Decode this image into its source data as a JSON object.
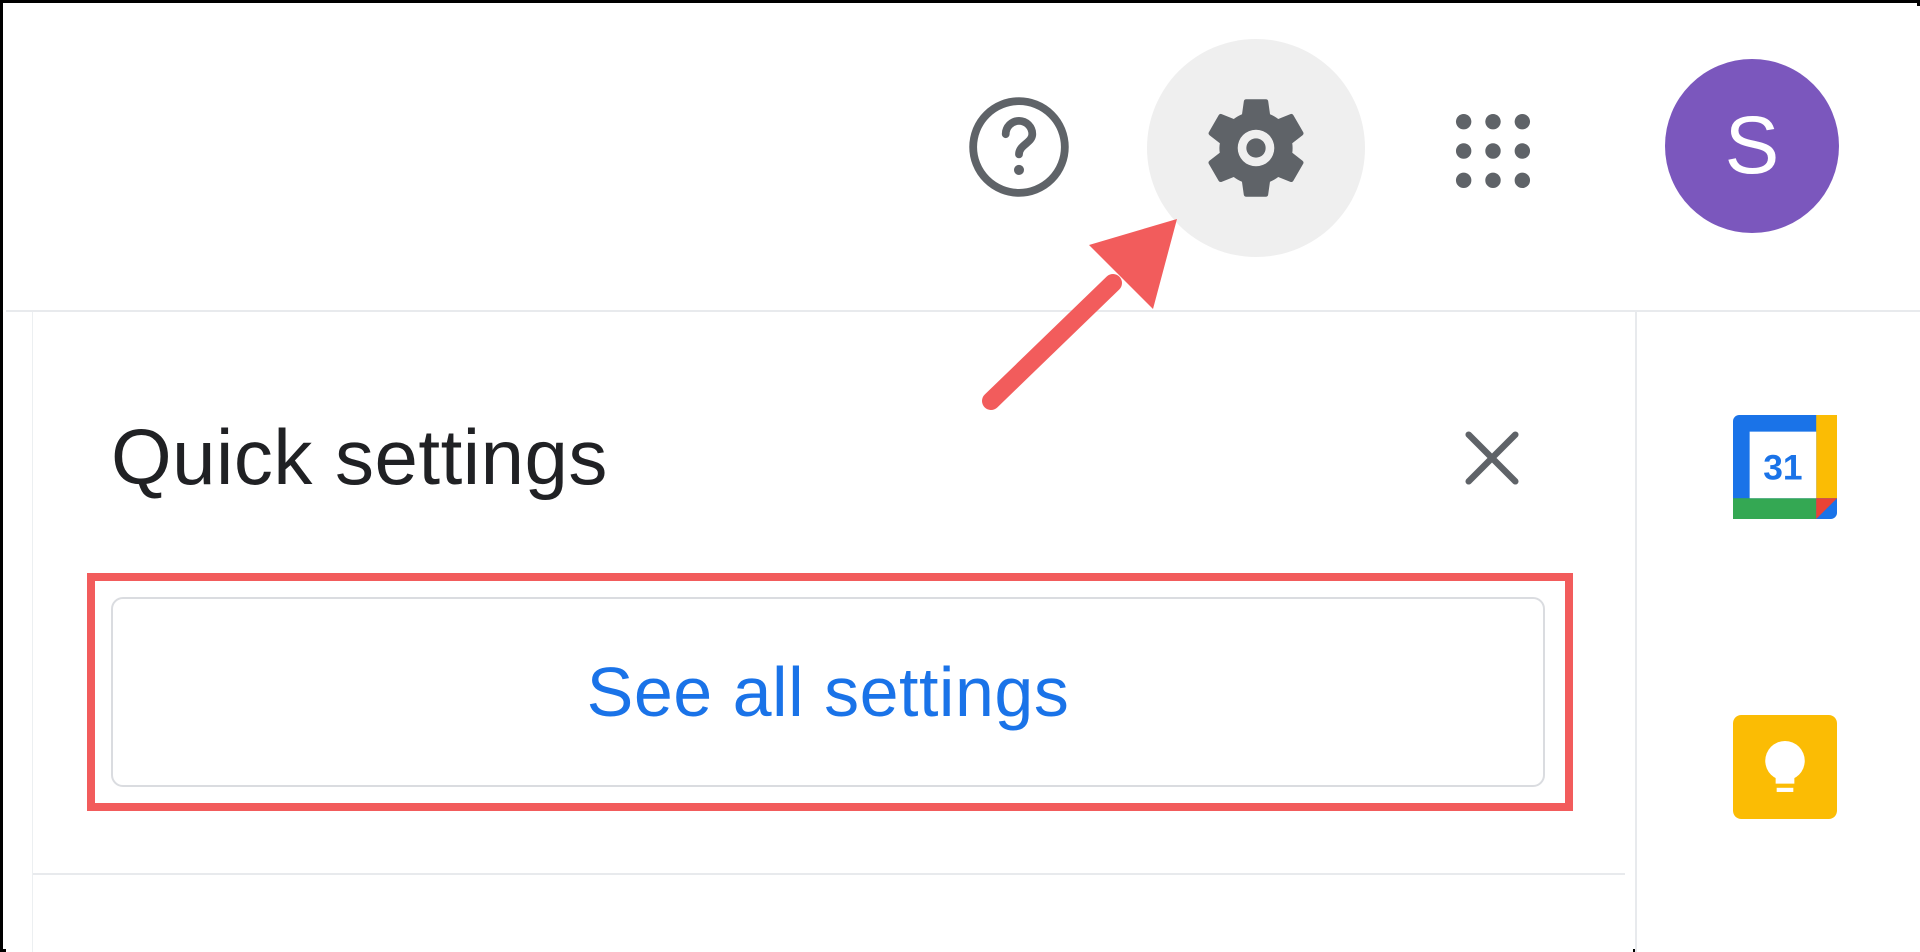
{
  "header": {
    "help_icon": "help-circle-icon",
    "settings_icon": "gear-icon",
    "apps_icon": "apps-grid-icon",
    "avatar_initial": "S",
    "avatar_color": "#7b57bd"
  },
  "quick_settings": {
    "title": "Quick settings",
    "close_icon": "close-icon",
    "see_all_label": "See all settings"
  },
  "side_panel": {
    "items": [
      {
        "icon": "calendar-icon",
        "date": "31"
      },
      {
        "icon": "keep-icon"
      }
    ]
  },
  "colors": {
    "accent": "#1a73e8",
    "highlight": "#f25c5c",
    "icon_gray": "#5f6368"
  }
}
